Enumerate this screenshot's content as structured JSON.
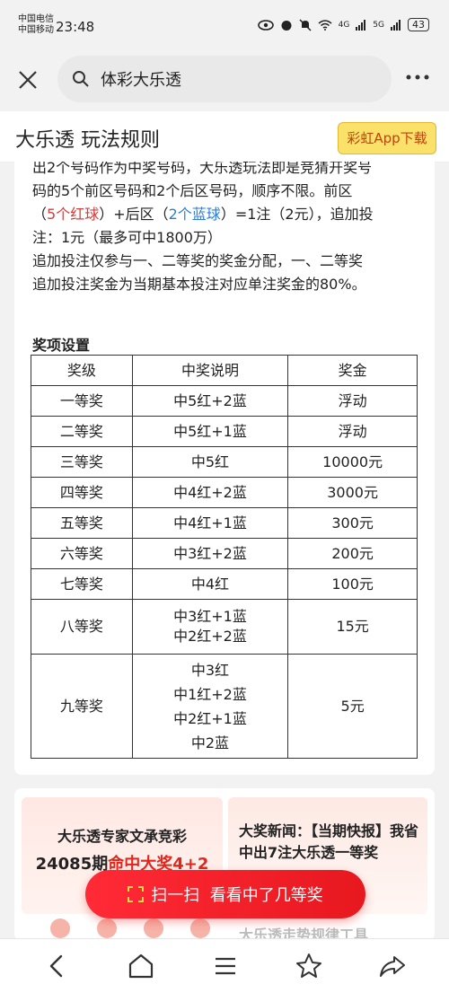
{
  "status": {
    "carrier1": "中国电信",
    "carrier2": "中国移动",
    "time": "23:48",
    "net1": "4G",
    "net2": "5G",
    "battery": "43"
  },
  "search": {
    "query": "体彩大乐透"
  },
  "page": {
    "title": "大乐透 玩法规则",
    "app_button": "彩虹App下载"
  },
  "rules": {
    "line1": "出2个号码作为中奖号码，大乐透玩法即是竞猜开奖号",
    "line2": "码的5个前区号码和2个后区号码，顺序不限。前区",
    "line3_a": "（",
    "line3_red": "5个红球",
    "line3_b": "）+后区（",
    "line3_blue": "2个蓝球",
    "line3_c": "）=1注（2元），追加投",
    "line4": "注：1元（最多可中1800万）",
    "line5": "追加投注仅参与一、二等奖的奖金分配，一、二等奖",
    "line6": "追加投注奖金为当期基本投注对应单注奖金的80%。"
  },
  "prize_section_title": "奖项设置",
  "prize_table": {
    "headers": [
      "奖级",
      "中奖说明",
      "奖金"
    ],
    "rows": [
      {
        "level": "一等奖",
        "desc": [
          "中5红+2蓝"
        ],
        "amount": "浮动"
      },
      {
        "level": "二等奖",
        "desc": [
          "中5红+1蓝"
        ],
        "amount": "浮动"
      },
      {
        "level": "三等奖",
        "desc": [
          "中5红"
        ],
        "amount": "10000元"
      },
      {
        "level": "四等奖",
        "desc": [
          "中4红+2蓝"
        ],
        "amount": "3000元"
      },
      {
        "level": "五等奖",
        "desc": [
          "中4红+1蓝"
        ],
        "amount": "300元"
      },
      {
        "level": "六等奖",
        "desc": [
          "中3红+2蓝"
        ],
        "amount": "200元"
      },
      {
        "level": "七等奖",
        "desc": [
          "中4红"
        ],
        "amount": "100元"
      },
      {
        "level": "八等奖",
        "desc": [
          "中3红+1蓝",
          "中2红+2蓝"
        ],
        "amount": "15元"
      },
      {
        "level": "九等奖",
        "desc": [
          "中3红",
          "中1红+2蓝",
          "中2红+1蓝",
          "中2蓝"
        ],
        "amount": "5元"
      }
    ]
  },
  "promo": {
    "card1_line1": "大乐透专家文承竞彩",
    "card1_period": "24085期",
    "card1_highlight": "命中大奖4+2",
    "card2_text": "大奖新闻：【当期快报】我省中出7注大乐透一等奖",
    "card3_text": "大乐透走势规律工具"
  },
  "scan_button": "扫一扫  看看中了几等奖",
  "colors": {
    "red": "#d63c3c",
    "blue": "#2b7dd8",
    "accent_red": "#e8181f",
    "app_btn_bg": "#f9e16a"
  }
}
